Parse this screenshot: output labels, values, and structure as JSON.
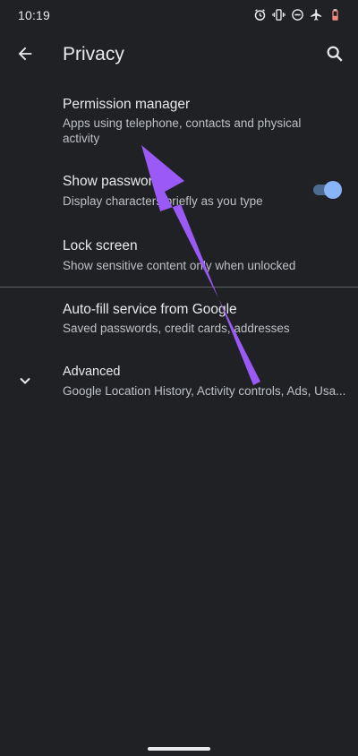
{
  "status_bar": {
    "time": "10:19",
    "icons": [
      "alarm-icon",
      "vibrate-icon",
      "do-not-disturb-icon",
      "airplane-mode-icon",
      "battery-low-icon"
    ]
  },
  "app_bar": {
    "title": "Privacy",
    "back_icon": "arrow-back-icon",
    "search_icon": "search-icon"
  },
  "preferences": [
    {
      "title": "Permission manager",
      "summary": "Apps using telephone, contacts and physical activity"
    },
    {
      "title": "Show passwords",
      "summary": "Display characters briefly as you type",
      "toggle_on": true
    },
    {
      "title": "Lock screen",
      "summary": "Show sensitive content only when unlocked"
    },
    {
      "title": "Auto-fill service from Google",
      "summary": "Saved passwords, credit cards, addresses"
    },
    {
      "title": "Advanced",
      "summary": "Google Location History, Activity controls, Ads, Usa...",
      "icon": "chevron-down-icon"
    }
  ],
  "colors": {
    "background": "#202124",
    "accent": "#8ab4f8",
    "annotation_arrow": "#9b59f5",
    "divider": "#5f6368"
  },
  "annotation": {
    "type": "arrow",
    "points_to": "Permission manager"
  }
}
